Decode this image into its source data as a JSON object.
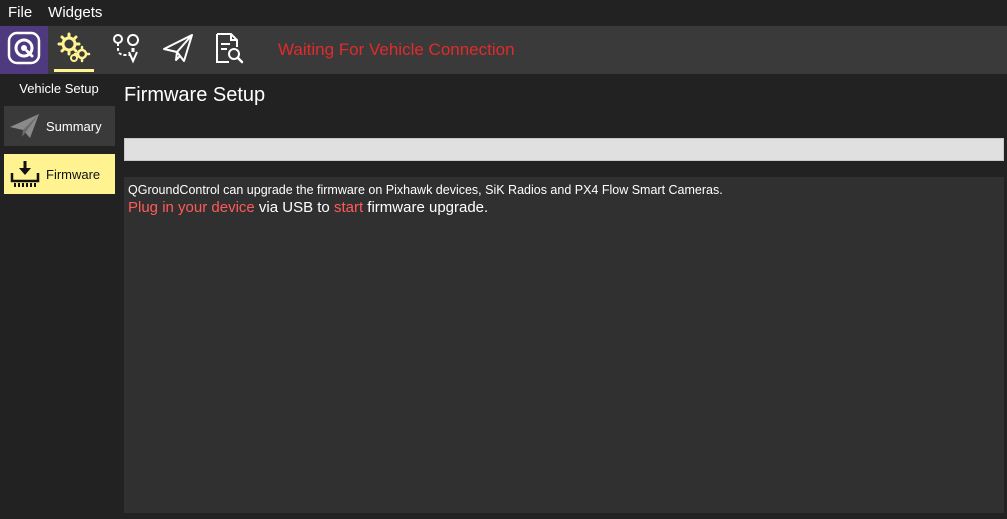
{
  "menubar": {
    "items": [
      "File",
      "Widgets"
    ]
  },
  "toolbar": {
    "status_text": "Waiting For Vehicle Connection",
    "buttons": [
      "logo-icon",
      "vehicle-setup-gears-icon",
      "plan-icon",
      "fly-icon",
      "analyze-icon"
    ],
    "active": "vehicle-setup"
  },
  "sidebar": {
    "title": "Vehicle Setup",
    "items": [
      {
        "label": "Summary",
        "icon": "paper-plane-icon",
        "selected": false
      },
      {
        "label": "Firmware",
        "icon": "download-icon",
        "selected": true
      }
    ]
  },
  "main": {
    "title": "Firmware Setup",
    "progress": 0,
    "info_line": "QGroundControl can upgrade the firmware on Pixhawk devices, SiK Radios and PX4 Flow Smart Cameras.",
    "instruction": {
      "part1": "Plug in your device",
      "part2": " via USB to ",
      "part3": "start",
      "part4": " firmware upgrade."
    }
  },
  "colors": {
    "status_red": "#e02b2b",
    "highlight_yellow": "#fff291",
    "logo_purple": "#4e3a7f"
  }
}
